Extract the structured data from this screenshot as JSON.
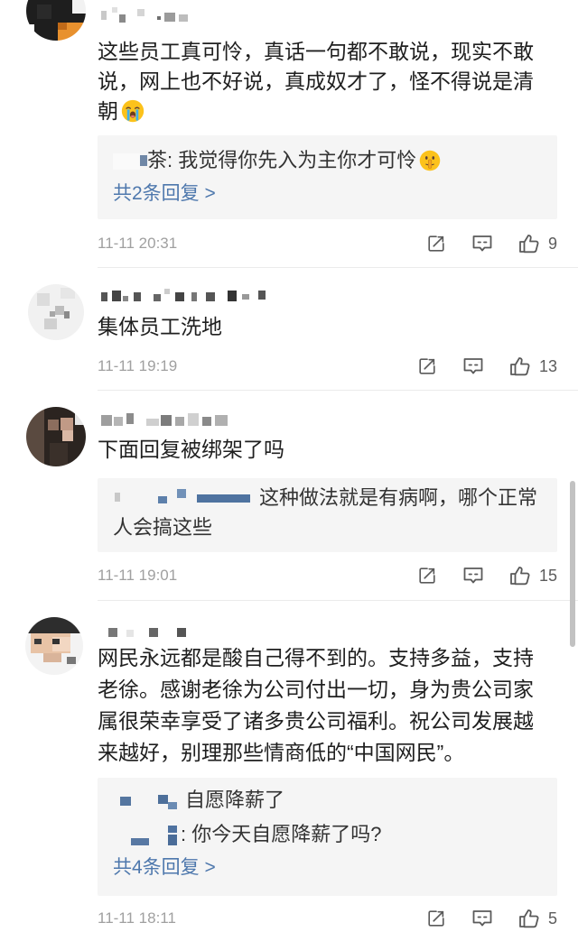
{
  "comments": [
    {
      "text": "这些员工真可怜，真话一句都不敢说，现实不敢说，网上也不好说，真成奴才了，怪不得说是清朝",
      "emoji": "loudly-crying-face-icon",
      "replies": [
        {
          "text": "茶: 我觉得你先入为主你才可怜",
          "emoji": "shushing-face-icon"
        }
      ],
      "more_replies": "共2条回复 >",
      "time": "11-11 20:31",
      "likes": "9"
    },
    {
      "text": "集体员工洗地",
      "time": "11-11 19:19",
      "likes": "13"
    },
    {
      "text": "下面回复被绑架了吗",
      "replies": [
        {
          "text": "这种做法就是有病啊，哪个正常人会搞这些"
        }
      ],
      "time": "11-11 19:01",
      "likes": "15"
    },
    {
      "text": "网民永远都是酸自己得不到的。支持多益，支持老徐。感谢老徐为公司付出一切，身为贵公司家属很荣幸享受了诸多贵公司福利。祝公司发展越来越好，别理那些情商低的“中国网民”。",
      "replies": [
        {
          "text": "自愿降薪了"
        },
        {
          "text": ": 你今天自愿降薪了吗?"
        }
      ],
      "more_replies": "共4条回复 >",
      "time": "11-11 18:11",
      "likes": "5"
    }
  ],
  "icons": {
    "share": "share-icon",
    "comment": "comment-icon",
    "like": "thumbs-up-icon"
  },
  "colors": {
    "text": "#1f1f1f",
    "reply_text": "#333333",
    "link": "#4e78ad",
    "meta": "#a0a0a0",
    "reply_bg": "#f5f5f5",
    "icon": "#5a5a5a"
  }
}
